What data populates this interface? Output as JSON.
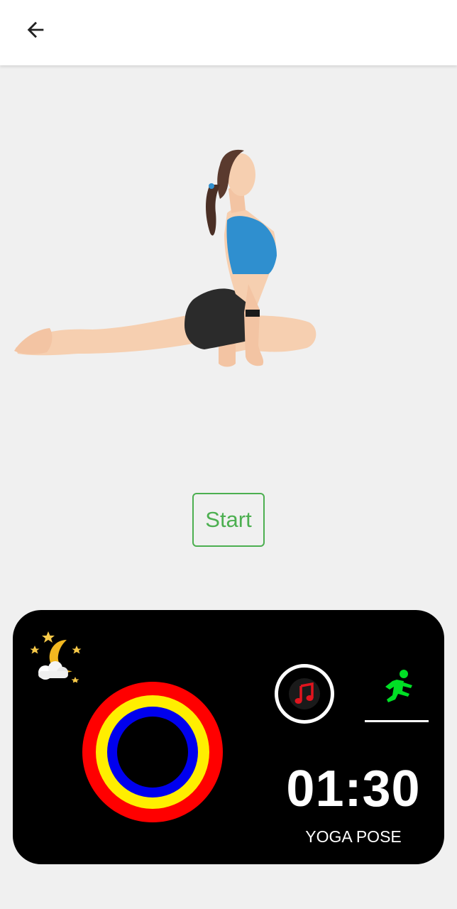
{
  "appbar": {
    "back_icon": "arrow-left-icon"
  },
  "exercise": {
    "start_label": "Start"
  },
  "widget": {
    "moon_icon": "moon-stars-icon",
    "music_icon": "music-note-icon",
    "run_icon": "running-person-icon",
    "timer": "01:30",
    "pose_label": "YOGA POSE",
    "ring_colors": [
      "#ff0000",
      "#ffee00",
      "#0000ee"
    ]
  },
  "colors": {
    "accent": "#4caf50",
    "run_icon": "#00e025",
    "music_note": "#e0141e",
    "widget_bg": "#000000",
    "page_bg": "#f0f0f0"
  }
}
